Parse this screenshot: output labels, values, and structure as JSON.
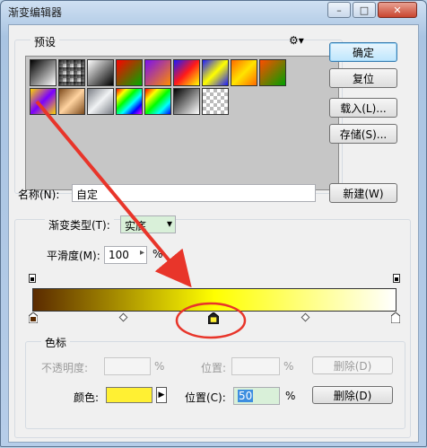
{
  "window": {
    "title": "渐变编辑器",
    "buttons": [
      "–",
      "□",
      "✕"
    ]
  },
  "presets": {
    "label": "预设",
    "menu_icon": "gear-icon",
    "row1": [
      {
        "colors": [
          "#000000",
          "#ffffff"
        ]
      },
      {
        "colors": [
          "#000000",
          "transparent"
        ]
      },
      {
        "colors": [
          "#ffffff",
          "#000000"
        ]
      },
      {
        "colors": [
          "#ff0000",
          "#00aa00"
        ]
      },
      {
        "colors": [
          "#7a0ff0",
          "#ff8c00"
        ]
      },
      {
        "colors": [
          "#1a1aff",
          "#ff1a1a",
          "#ffff00"
        ]
      },
      {
        "colors": [
          "#1c1cff",
          "#ffff00",
          "#1c1cff"
        ]
      },
      {
        "colors": [
          "#ff6a00",
          "#ffe400",
          "#ff6a00"
        ]
      },
      {
        "colors": [
          "#ff4d00",
          "#00a000"
        ]
      }
    ],
    "row2": [
      {
        "colors": [
          "#ffd400",
          "#7a00ff",
          "#ffd400"
        ]
      },
      {
        "colors": [
          "#7c4a1c",
          "#ffd3a0",
          "#7c4a1c"
        ]
      },
      {
        "colors": [
          "#7b7f86",
          "#f1f3f5",
          "#7b7f86"
        ]
      },
      {
        "colors": [
          "#ff0000",
          "#ffff00",
          "#00ff00",
          "#00ffff",
          "#0000ff",
          "#ff00ff"
        ]
      },
      {
        "colors": [
          "#ff0000",
          "#ffff00",
          "#00ff00",
          "#00ffff",
          "#0000ff"
        ]
      },
      {
        "colors": [
          "#000000",
          "#ffffff"
        ]
      },
      {
        "colors": [
          "transparent"
        ]
      }
    ]
  },
  "side_buttons": {
    "ok": "确定",
    "reset": "复位",
    "load": "载入(L)...",
    "save": "存储(S)...",
    "new": "新建(W)"
  },
  "name": {
    "label": "名称(N):",
    "value": "自定"
  },
  "gradient": {
    "type_label": "渐变类型(T):",
    "type_value": "实底",
    "smooth_label": "平滑度(M):",
    "smooth_value": "100",
    "smooth_unit": "%",
    "colors": [
      "#5a2a00",
      "#ffff00",
      "#ffffff"
    ],
    "stops": {
      "opacity_stops": 2,
      "color_stops": [
        "#5a2a00",
        "#fff033",
        "#ffffff"
      ]
    }
  },
  "color_stop_panel": {
    "label": "色标",
    "opacity_label": "不透明度:",
    "opacity_value": "",
    "opacity_unit": "%",
    "opacity_position_label": "位置:",
    "opacity_position_value": "",
    "opacity_position_unit": "%",
    "delete_top": "删除(D)",
    "color_label": "颜色:",
    "color_value": "#fff033",
    "position_label": "位置(C):",
    "position_value": "50",
    "position_unit": "%",
    "delete_bottom": "删除(D)"
  }
}
